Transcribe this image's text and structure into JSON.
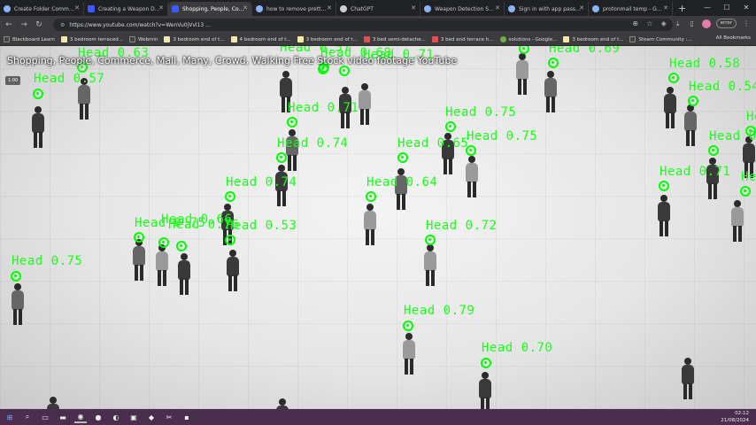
{
  "browser": {
    "tabs": [
      {
        "label": "Create Folder Command",
        "icon": "page-icon",
        "active": false
      },
      {
        "label": "Creating a Weapon Dete",
        "icon": "youtube-icon",
        "active": false
      },
      {
        "label": "Shopping, People, Comm",
        "icon": "youtube-icon",
        "active": true
      },
      {
        "label": "how to remove pretty in",
        "icon": "page-icon",
        "active": false
      },
      {
        "label": "ChatGPT",
        "icon": "chatgpt-icon",
        "active": false
      },
      {
        "label": "Weapon Detection Syste",
        "icon": "page-icon",
        "active": false
      },
      {
        "label": "Sign in with app passwo",
        "icon": "google-icon",
        "active": false
      },
      {
        "label": "protonmail temp - Google",
        "icon": "google-icon",
        "active": false
      }
    ],
    "new_tab": "+",
    "window_controls": {
      "minimize": "—",
      "maximize": "☐",
      "close": "✕"
    },
    "nav": {
      "back": "←",
      "forward": "→",
      "reload": "↻"
    },
    "url": "https://www.youtube.com/watch?v=WenVu0jVvl13 ...",
    "error_badge": "error",
    "bookmarks": [
      {
        "label": "Blackboard Learn",
        "color": "dark"
      },
      {
        "label": "3 bedroom terraced...",
        "color": "paper"
      },
      {
        "label": "Webmin",
        "color": "dark"
      },
      {
        "label": "3 bedroom end of t...",
        "color": "paper"
      },
      {
        "label": "4 bedroom end of t...",
        "color": "paper"
      },
      {
        "label": "3 bedroom end of t...",
        "color": "paper"
      },
      {
        "label": "3 bed semi-detache...",
        "color": "red"
      },
      {
        "label": "3 bed end terrace h...",
        "color": "red"
      },
      {
        "label": "solutions - Google...",
        "color": "green"
      },
      {
        "label": "3 bedroom end of t...",
        "color": "paper"
      },
      {
        "label": "Steam Community :...",
        "color": "dark"
      }
    ],
    "all_bookmarks": "All Bookmarks"
  },
  "video": {
    "title": "Shopping, People, Commerce, Mall, Many, Crowd, Walking Free Stock video footage YouTube",
    "time_badge": "1:00",
    "detection_color": "#00ff00",
    "detections": [
      {
        "label": "Head 0.57"
      },
      {
        "label": "Head 0.63"
      },
      {
        "label": "Head 0.57"
      },
      {
        "label": "Head 0.68"
      },
      {
        "label": "Head 0.71"
      },
      {
        "label": "Head 0.40"
      },
      {
        "label": "Head 0.69"
      },
      {
        "label": "Head 0.58"
      },
      {
        "label": "Head 0.54"
      },
      {
        "label": "Head 0.71"
      },
      {
        "label": "Head 0.75"
      },
      {
        "label": "Head 0.75"
      },
      {
        "label": "Head 0.74"
      },
      {
        "label": "Head 0.65"
      },
      {
        "label": "Head 0.55"
      },
      {
        "label": "Head 0.70"
      },
      {
        "label": "Head 0.74"
      },
      {
        "label": "Head 0.64"
      },
      {
        "label": "Head 0.71"
      },
      {
        "label": "Head 0.75"
      },
      {
        "label": "Head 0.75"
      },
      {
        "label": "Head 0.66"
      },
      {
        "label": "Head 0.76"
      },
      {
        "label": "Head 0.53"
      },
      {
        "label": "Head 0.72"
      },
      {
        "label": "Head 0.75"
      },
      {
        "label": "Head 0.79"
      },
      {
        "label": "Head 0.70"
      }
    ]
  },
  "taskbar": {
    "items": [
      "windows-icon",
      "search-icon",
      "task-view-icon",
      "file-explorer-icon",
      "chrome-icon",
      "spotify-icon",
      "edge-icon",
      "terminal-icon",
      "vscode-icon",
      "snipping-tool-icon",
      "app-icon"
    ],
    "time": "02:12",
    "date": "21/08/2024"
  }
}
